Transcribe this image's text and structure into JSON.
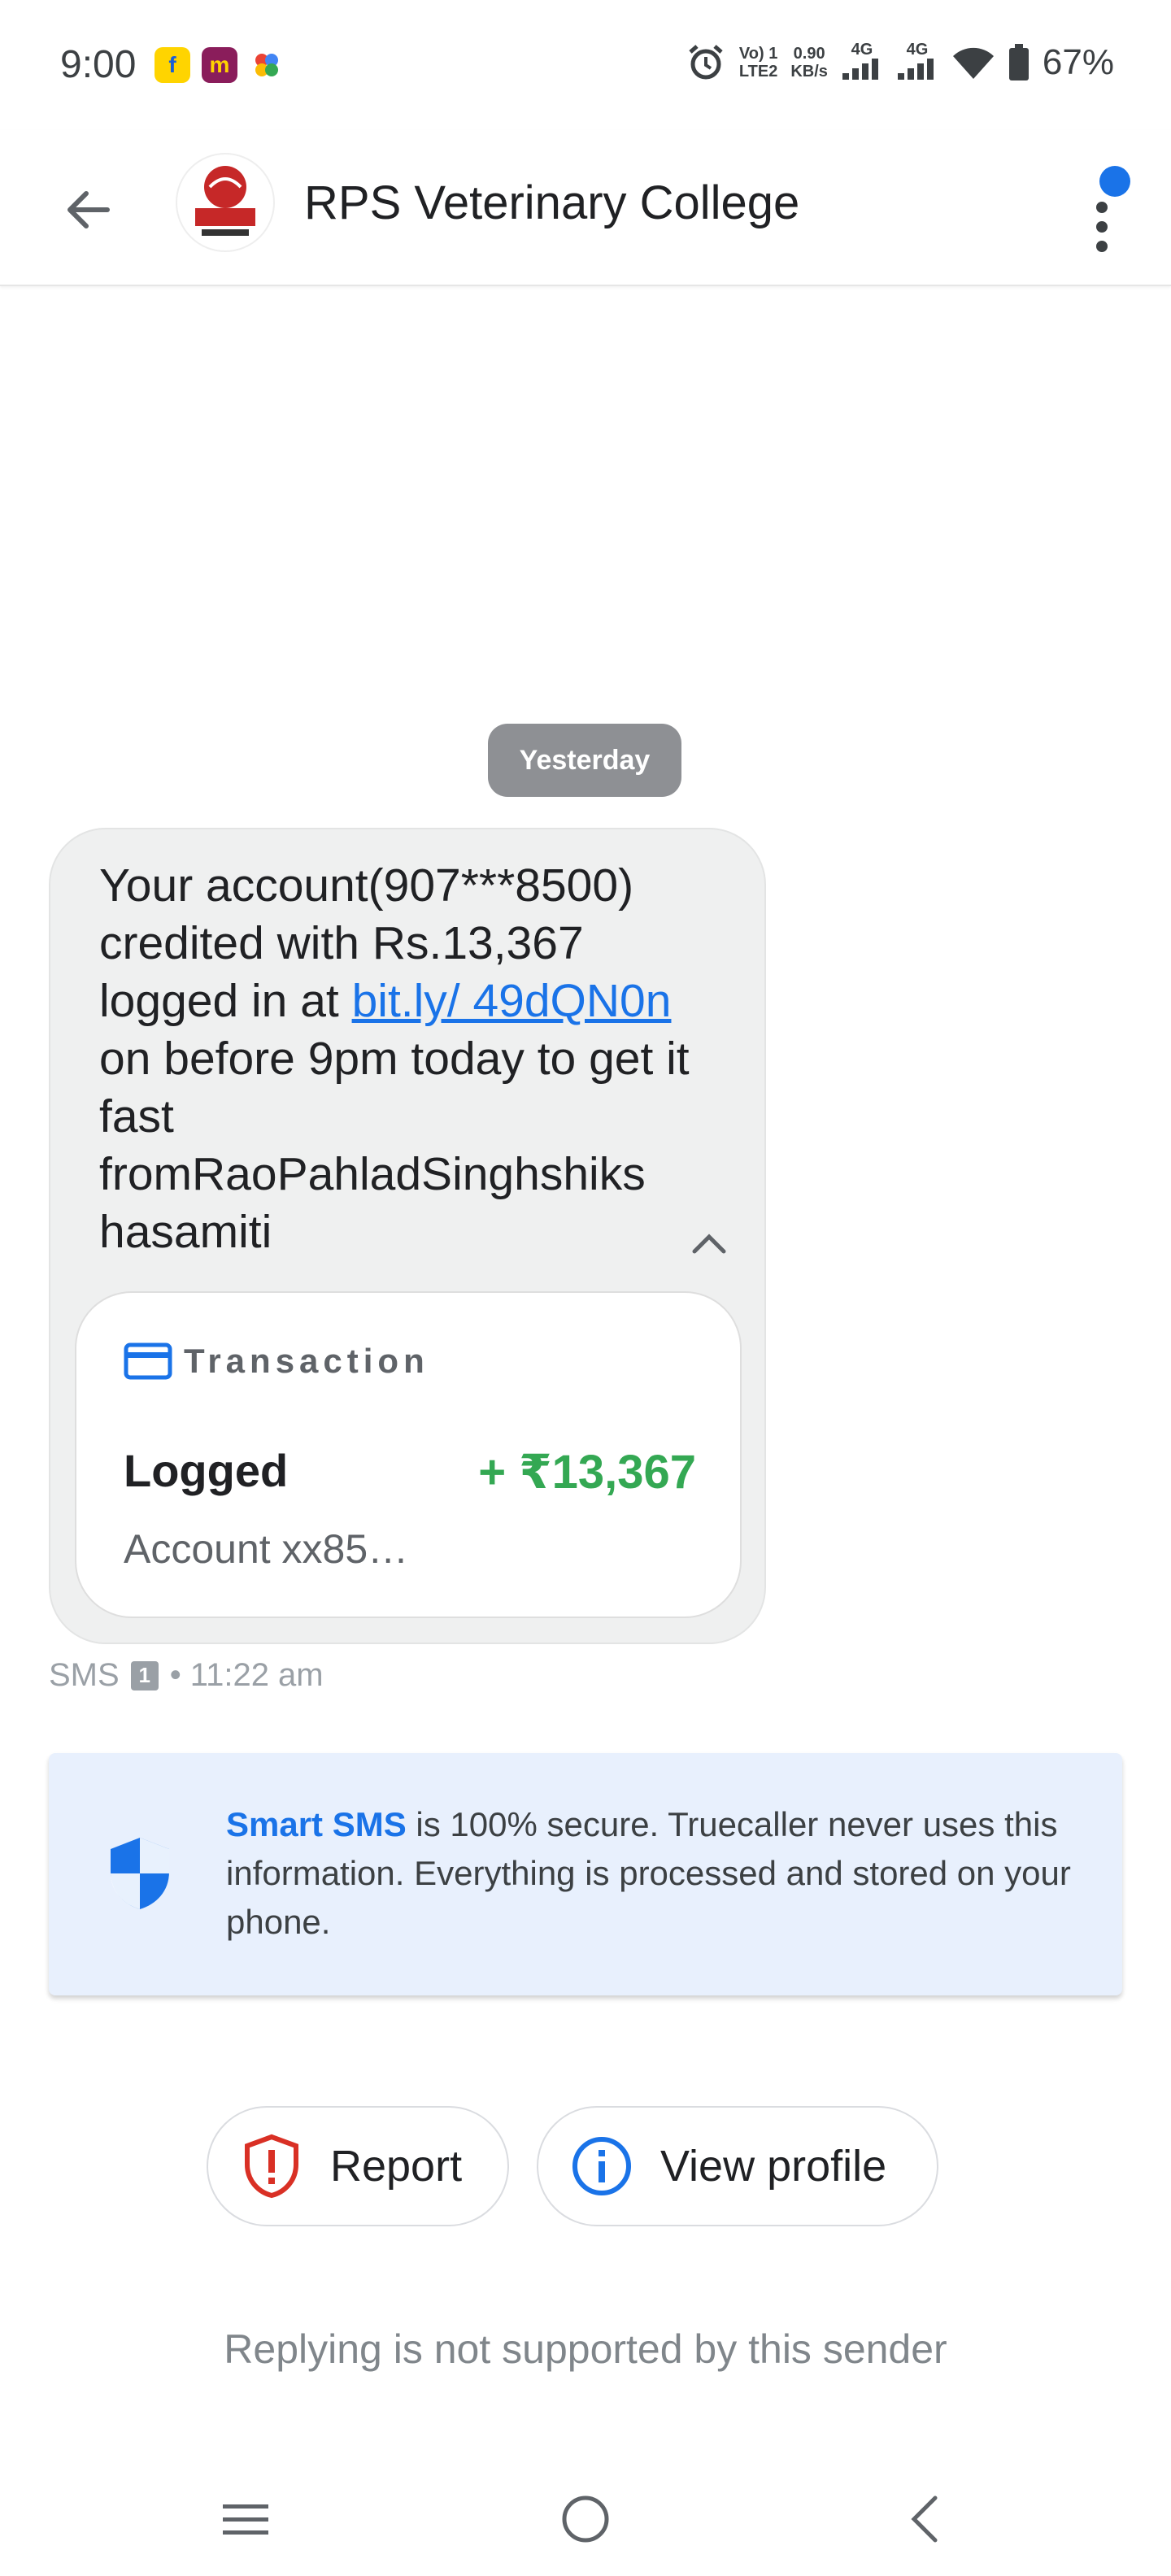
{
  "status_bar": {
    "time": "9:00",
    "network_top": "Vo) 1",
    "network_bottom": "LTE2",
    "speed_top": "0.90",
    "speed_bottom": "KB/s",
    "signal1": "4G",
    "signal2": "4G",
    "battery": "67%"
  },
  "header": {
    "title": "RPS Veterinary College",
    "avatar_alt": "RPS logo"
  },
  "conversation": {
    "date_chip": "Yesterday",
    "message": {
      "text_before_link": "Your account(907***8500) credited with Rs.13,367 logged in at ",
      "link": "bit.ly/ 49dQN0n",
      "text_after_link": " on before 9pm today to get it fast fromRaoPahladSinghshiks hasamiti"
    },
    "transaction": {
      "heading": "Transaction",
      "status": "Logged",
      "amount": "+ ₹13,367",
      "account": "Account xx85…"
    },
    "meta": {
      "type": "SMS",
      "sim": "1",
      "time": "• 11:22 am"
    }
  },
  "smart_sms": {
    "brand": "Smart SMS",
    "text": " is 100% secure. Truecaller never uses this information. Everything is processed and stored on your phone."
  },
  "actions": {
    "report": "Report",
    "view_profile": "View profile"
  },
  "footer": {
    "reply_note": "Replying is not supported by this sender"
  },
  "colors": {
    "accent": "#1a73e8",
    "success": "#34a853",
    "danger": "#d93025"
  }
}
